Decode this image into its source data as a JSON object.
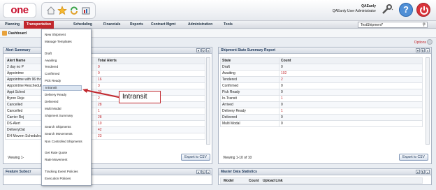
{
  "header": {
    "logo": "one",
    "user_name": "QAEanly",
    "user_role": "QAEanly User Administrator"
  },
  "nav": {
    "items": [
      "Planning",
      "Transportation",
      "Scheduling",
      "Financials",
      "Reports",
      "Contract Mgmt",
      "Administration",
      "Tools"
    ],
    "active": "Transportation",
    "search_value": "TestShipment*"
  },
  "breadcrumb": {
    "title": "Dashboard"
  },
  "options_label": "Options",
  "alert_panel": {
    "title": "Alert Summary",
    "columns": [
      "Alert Name",
      "Total Alerts"
    ],
    "rows": [
      [
        "2 day no P",
        "9"
      ],
      [
        "Appointme",
        "9"
      ],
      [
        "Appointme with 96 thr",
        "16"
      ],
      [
        "Appointme Rescheduled threshold",
        "3"
      ],
      [
        "Appt Sched",
        "39"
      ],
      [
        "Byron Reje",
        "2"
      ],
      [
        "Cancelled",
        "28"
      ],
      [
        "Cancelled",
        "1"
      ],
      [
        "Carrier Rej",
        "28"
      ],
      [
        "DS-Alert",
        "10"
      ],
      [
        "DeliveryDat",
        "42"
      ],
      [
        "EH Movem Scheduled",
        "23"
      ]
    ],
    "footer": "Viewing 1-",
    "export_label": "Export to CSV"
  },
  "feature_panel": {
    "title": "Feature Subscr"
  },
  "shipment_panel": {
    "title": "Shipment State Summary Report",
    "columns": [
      "State",
      "Count"
    ],
    "rows": [
      [
        "Draft",
        "0"
      ],
      [
        "Awaiting",
        "102"
      ],
      [
        "Tendered",
        "2"
      ],
      [
        "Confirmed",
        "0"
      ],
      [
        "Pick Ready",
        "0"
      ],
      [
        "In-Transit",
        "1"
      ],
      [
        "Arrived",
        "0"
      ],
      [
        "Delivery Ready",
        "1"
      ],
      [
        "Delivered",
        "0"
      ],
      [
        "Multi Modal",
        "0"
      ]
    ],
    "footer": "Viewing 1-10 of 10",
    "export_label": "Export to CSV"
  },
  "master_panel": {
    "title": "Master Data Statistics",
    "columns": [
      "Model",
      "Count",
      "Upload Link"
    ]
  },
  "menu": {
    "items": [
      "New Shipment",
      "Manage Templates",
      "Draft",
      "Awaiting",
      "Tendered",
      "Confirmed",
      "Pick Ready",
      "Intransit",
      "Delivery Ready",
      "Delivered",
      "Multi Modal",
      "Shipment Summary",
      "Search Shipments",
      "Search Movements",
      "Non Controlled Shipments",
      "Get Rate Quote",
      "Rate Movement",
      "Tracking Event Policies",
      "Execution Policies"
    ],
    "highlighted": "Intransit"
  },
  "callout": {
    "text": "Intransit"
  },
  "colors": {
    "brand_red": "#c1272d",
    "panel_header": "#d6dce5",
    "link_red": "#c1272d"
  }
}
